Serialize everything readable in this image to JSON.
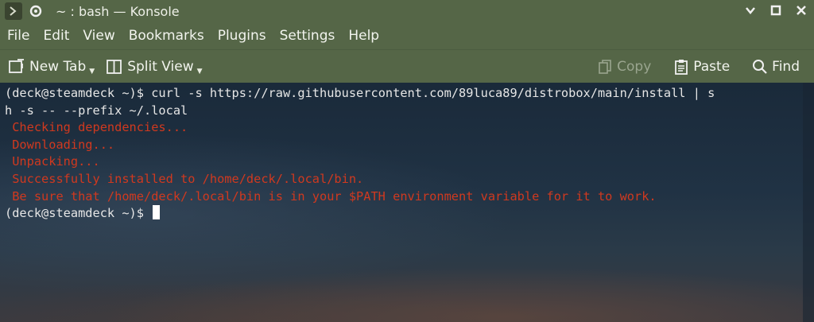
{
  "window": {
    "title": "~ : bash — Konsole"
  },
  "menu": {
    "items": [
      "File",
      "Edit",
      "View",
      "Bookmarks",
      "Plugins",
      "Settings",
      "Help"
    ]
  },
  "toolbar": {
    "new_tab": "New Tab",
    "split_view": "Split View",
    "copy": "Copy",
    "paste": "Paste",
    "find": "Find"
  },
  "terminal": {
    "prompt": "(deck@steamdeck ~)$",
    "command_line1": " curl -s https://raw.githubusercontent.com/89luca89/distrobox/main/install | s",
    "command_line2": "h -s -- --prefix ~/.local",
    "output": [
      " Checking dependencies...",
      " Downloading...",
      " Unpacking...",
      " Successfully installed to /home/deck/.local/bin.",
      " Be sure that /home/deck/.local/bin is in your $PATH environment variable for it to work."
    ],
    "prompt2": "(deck@steamdeck ~)$"
  },
  "colors": {
    "chrome": "#556647",
    "error_text": "#d0391f",
    "terminal_text": "#e6e6e6"
  }
}
